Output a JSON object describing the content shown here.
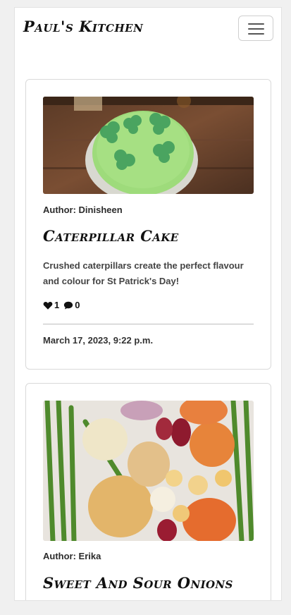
{
  "navbar": {
    "brand": "Paul's Kitchen",
    "toggle_icon": "hamburger-menu-icon"
  },
  "posts": [
    {
      "image_desc_icon": "image-placeholder",
      "author": "Author: Dinisheen",
      "title": "Caterpillar Cake",
      "excerpt": "Crushed caterpillars create the perfect flavour and colour for St Patrick's Day!",
      "likes": "1",
      "comments": "0",
      "like_icon": "heart-icon",
      "comment_icon": "comment-icon",
      "date": "March 17, 2023, 9:22 p.m."
    },
    {
      "image_desc_icon": "image-placeholder",
      "author": "Author: Erika",
      "title": "Sweet And Sour Onions"
    }
  ]
}
